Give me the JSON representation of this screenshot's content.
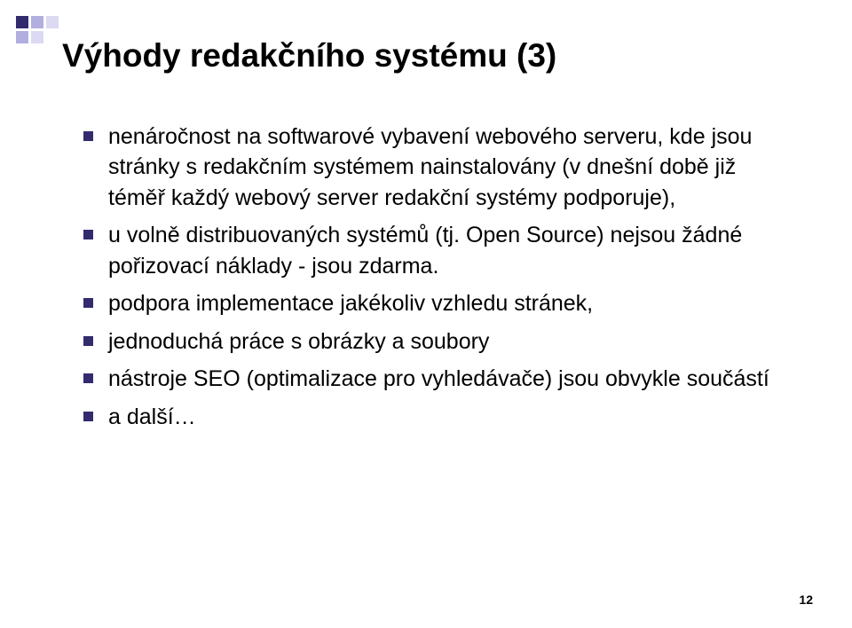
{
  "title": "Výhody redakčního systému (3)",
  "bullets": [
    "nenáročnost na softwarové vybavení webového serveru, kde jsou stránky s redakčním systémem nainstalovány (v dnešní době již téměř každý webový server redakční systémy podporuje),",
    "u volně distribuovaných systémů (tj. Open Source) nejsou žádné pořizovací náklady - jsou zdarma.",
    "podpora implementace jakékoliv vzhledu stránek,",
    "jednoduchá práce s obrázky a soubory",
    "nástroje SEO (optimalizace pro vyhledávače) jsou obvykle součástí",
    "a další…"
  ],
  "page_number": "12",
  "colors": {
    "accent_dark": "#322b6e",
    "accent_mid": "#b2aee0",
    "accent_light": "#dcd9f3"
  }
}
